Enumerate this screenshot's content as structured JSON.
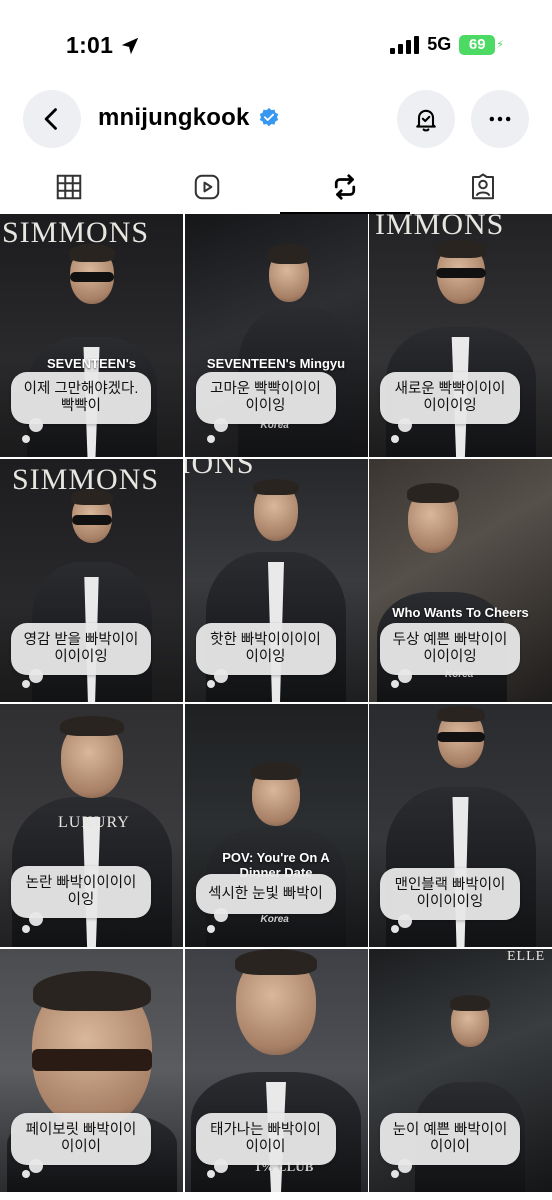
{
  "status_bar": {
    "time": "1:01",
    "network": "5G",
    "battery": "69"
  },
  "header": {
    "username": "mnijungkook"
  },
  "tabs": [
    {
      "icon": "grid-icon",
      "active": false
    },
    {
      "icon": "reels-icon",
      "active": false
    },
    {
      "icon": "reposts-icon",
      "active": true
    },
    {
      "icon": "tagged-icon",
      "active": false
    }
  ],
  "posts": [
    {
      "brand": "SIMMONS",
      "title": "SEVENTEEN's",
      "tag": "",
      "caption": "이제 그만해야겠다.\n빡빡이"
    },
    {
      "brand": "",
      "title": "SEVENTEEN's Mingyu",
      "tag": "Korea",
      "caption": "고마운 빡빡이이이\n이이잉"
    },
    {
      "brand": "IMMONS",
      "title": "",
      "tag": "",
      "caption": "새로운 빡빡이이이\n이이이잉"
    },
    {
      "brand": "SIMMONS",
      "title": "",
      "tag": "",
      "caption": "영감 받을 빠박이이\n이이이잉"
    },
    {
      "brand": "IONS",
      "title": "",
      "tag": "",
      "caption": "핫한 빠박이이이이\n이이잉"
    },
    {
      "brand": "",
      "title": "Who Wants To Cheers",
      "tag": "Korea",
      "caption": "두상 예쁜 빠박이이\n이이이잉"
    },
    {
      "brand": "LUXURY",
      "title": "",
      "tag": "",
      "caption": "논란 빠박이이이이\n이잉"
    },
    {
      "brand": "",
      "title": "POV: You're On A\nDinner Date",
      "tag": "Korea",
      "caption": "섹시한 눈빛 빠박이"
    },
    {
      "brand": "",
      "title": "",
      "tag": "",
      "caption": "맨인블랙 빠박이이\n이이이이잉"
    },
    {
      "brand": "",
      "title": "",
      "tag": "",
      "caption": "페이보릿 빠박이이\n이이이"
    },
    {
      "brand": "1% CLUB",
      "title": "",
      "tag": "",
      "caption": "태가나는 빠박이이\n이이이"
    },
    {
      "brand": "ELLE",
      "title": "",
      "tag": "",
      "caption": "눈이 예쁜 빠박이이\n이이이"
    }
  ],
  "colors": {
    "battery": "#4cd964",
    "verified": "#3897f0",
    "button_bg": "#eeeff2"
  }
}
